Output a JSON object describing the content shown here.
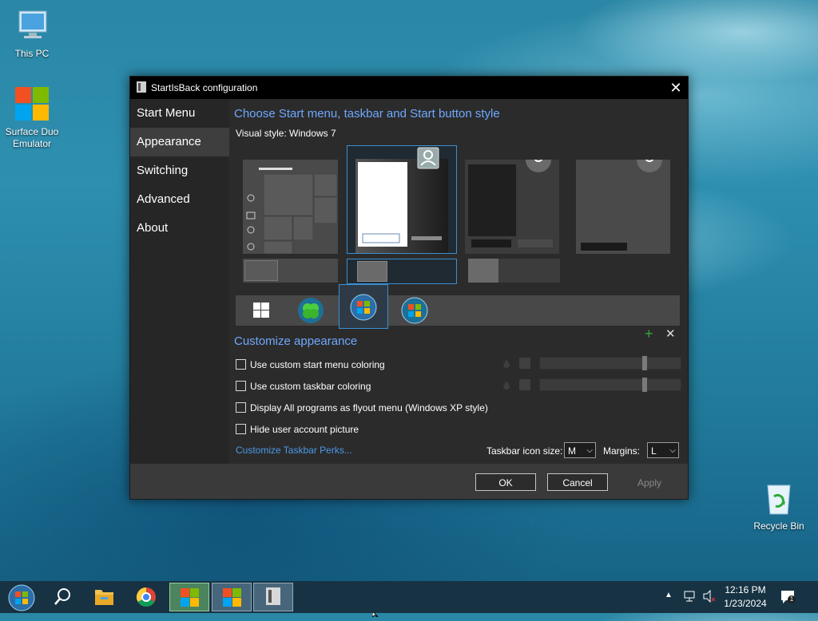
{
  "desktop": {
    "icons": [
      {
        "label": "This PC"
      },
      {
        "label": "Surface Duo Emulator"
      },
      {
        "label": "Recycle Bin"
      }
    ]
  },
  "window": {
    "title": "StartIsBack configuration",
    "nav": [
      "Start Menu",
      "Appearance",
      "Switching",
      "Advanced",
      "About"
    ],
    "selected_nav": "Appearance",
    "style_heading": "Choose Start menu, taskbar and Start button style",
    "visual_style_label": "Visual style:",
    "visual_style_value": "Windows 7",
    "customize_heading": "Customize appearance",
    "checkboxes": [
      {
        "label": "Use custom start menu coloring",
        "checked": false
      },
      {
        "label": "Use custom taskbar coloring",
        "checked": false
      },
      {
        "label": "Display All programs as flyout menu (Windows XP style)",
        "checked": false
      },
      {
        "label": "Hide user account picture",
        "checked": false
      }
    ],
    "perks_link": "Customize Taskbar Perks...",
    "icon_size_label": "Taskbar icon size:",
    "icon_size_value": "M",
    "margins_label": "Margins:",
    "margins_value": "L",
    "buttons": {
      "ok": "OK",
      "cancel": "Cancel",
      "apply": "Apply"
    }
  },
  "taskbar": {
    "clock_time": "12:16 PM",
    "clock_date": "1/23/2024",
    "notification_count": "1"
  },
  "colors": {
    "accent_link": "#6fa8ff",
    "window_bg": "#2b2b2b"
  }
}
